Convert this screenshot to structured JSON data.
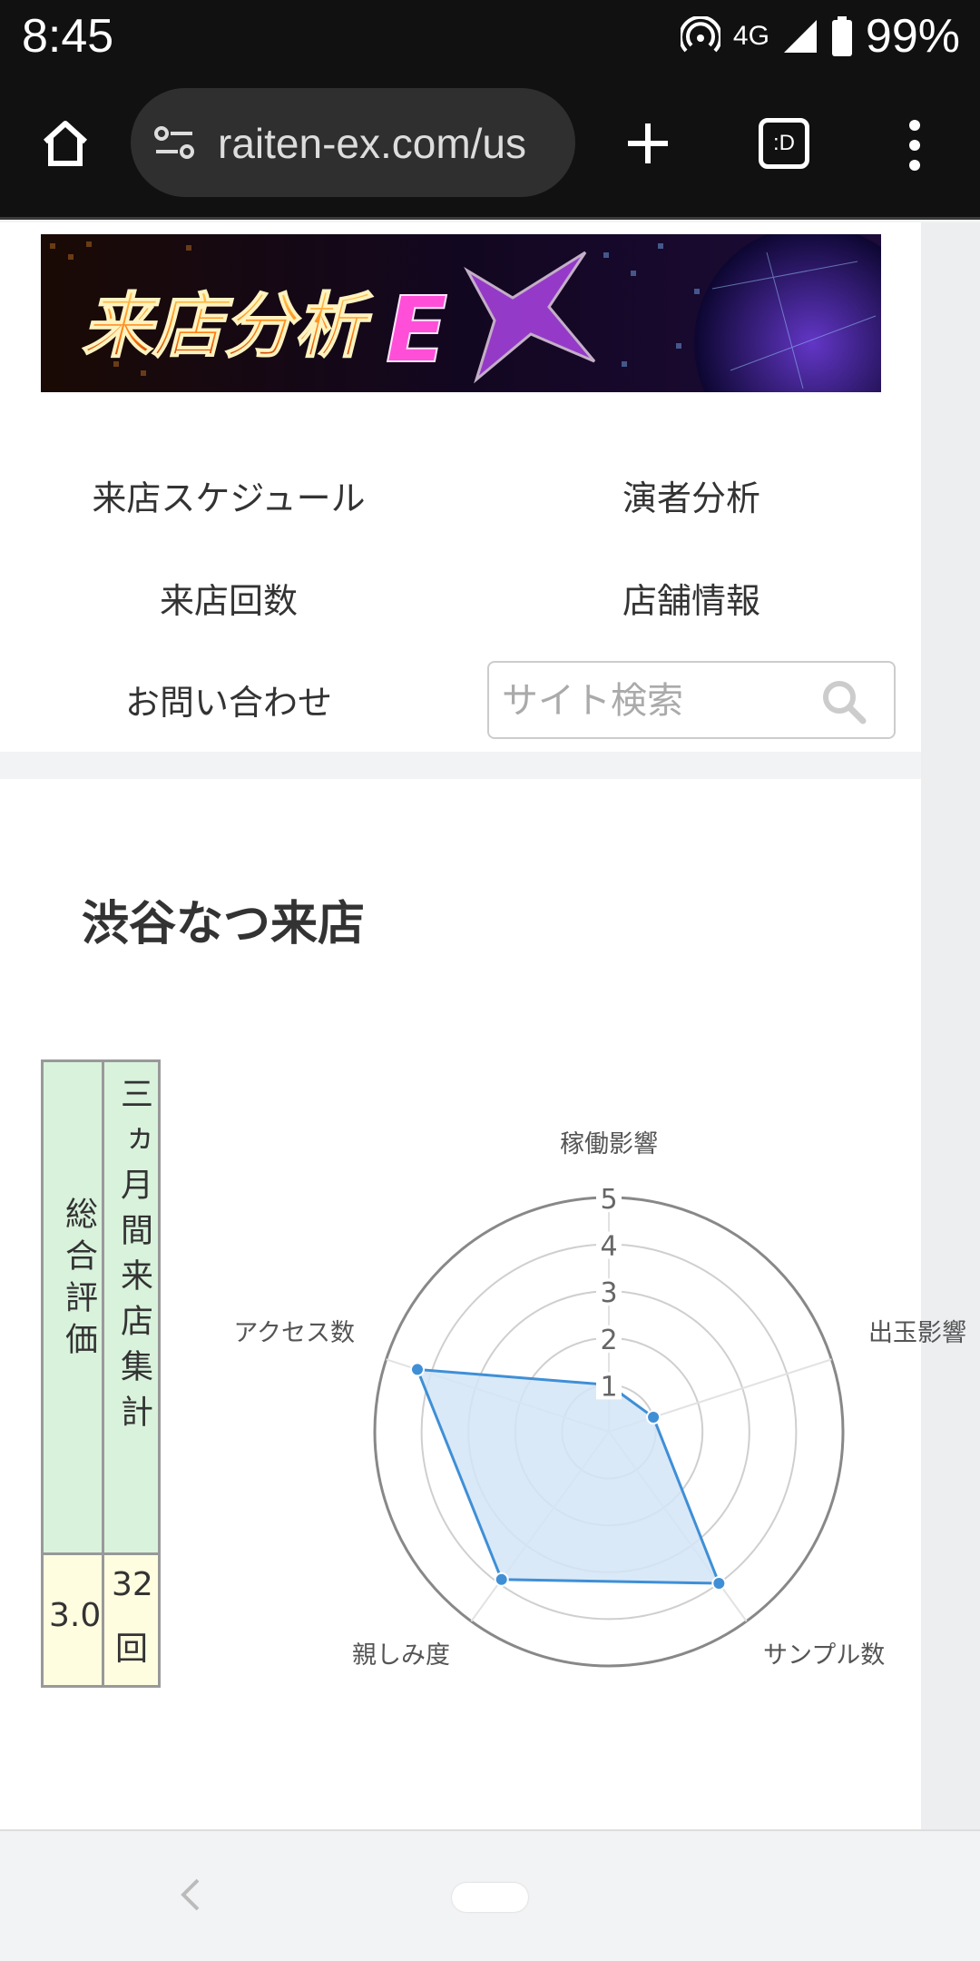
{
  "status_bar": {
    "time": "8:45",
    "network": "4G",
    "battery": "99%"
  },
  "browser": {
    "url": "raiten-ex.com/us",
    "home_icon": "home-icon",
    "site_info_icon": "site-settings-icon",
    "new_tab_icon": "plus-icon",
    "tabs_icon": "tab-switcher-icon",
    "tabs_label": ":D",
    "menu_icon": "more-vert-icon"
  },
  "nav": {
    "items": [
      "来店スケジュール",
      "演者分析",
      "来店回数",
      "店舗情報",
      "お問い合わせ"
    ],
    "search_placeholder": "サイト検索"
  },
  "main": {
    "title": "渋谷なつ来店",
    "summary_table": {
      "col1_header": "総合評価",
      "col2_header": "三ヵ月間来店集計",
      "col1_value": "3.0",
      "col2_value_num": "32",
      "col2_value_unit": "回"
    }
  },
  "chart_data": {
    "type": "radar",
    "categories": [
      "稼働影響",
      "出玉影響",
      "サンプル数",
      "親しみ度",
      "アクセス数"
    ],
    "series": [
      {
        "values": [
          1.0,
          1.0,
          4.0,
          3.9,
          4.3
        ]
      }
    ],
    "r_ticks": [
      "1",
      "2",
      "3",
      "4",
      "5"
    ],
    "rlim": [
      0,
      5
    ],
    "colors": {
      "line": "#3f8fd6",
      "fill": "#d3e5f7",
      "grid": "#cfcfcf",
      "outer": "#888888"
    }
  }
}
